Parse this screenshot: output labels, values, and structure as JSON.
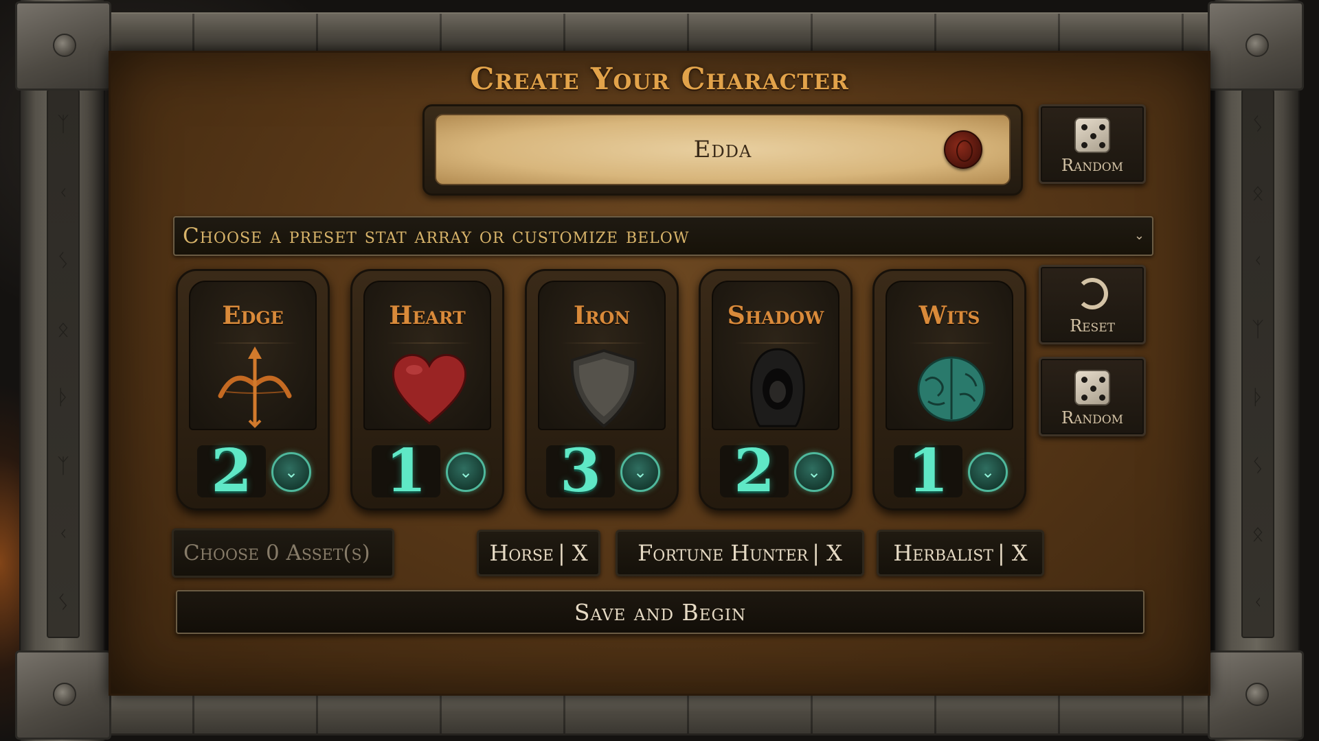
{
  "title": "Create Your Character",
  "name_field": {
    "value": "Edda"
  },
  "buttons": {
    "random_name": "Random",
    "reset": "Reset",
    "random_stats": "Random",
    "save": "Save and Begin"
  },
  "preset": {
    "selected": "Choose a preset stat array or customize below"
  },
  "stats": [
    {
      "label": "Edge",
      "value": "2",
      "icon": "bow-arrow-icon"
    },
    {
      "label": "Heart",
      "value": "1",
      "icon": "heart-icon"
    },
    {
      "label": "Iron",
      "value": "3",
      "icon": "shield-icon"
    },
    {
      "label": "Shadow",
      "value": "2",
      "icon": "hooded-figure-icon"
    },
    {
      "label": "Wits",
      "value": "1",
      "icon": "brain-icon"
    }
  ],
  "assets": {
    "placeholder": "Choose 0 Asset(s)",
    "selected": [
      {
        "name": "Horse",
        "remove": "| X"
      },
      {
        "name": "Fortune Hunter",
        "remove": "| X"
      },
      {
        "name": "Herbalist",
        "remove": "| X"
      }
    ]
  },
  "colors": {
    "title": "#e2a34a",
    "stat_label": "#d98a3a",
    "stat_value": "#5fe8c6",
    "panel": "#573717"
  }
}
